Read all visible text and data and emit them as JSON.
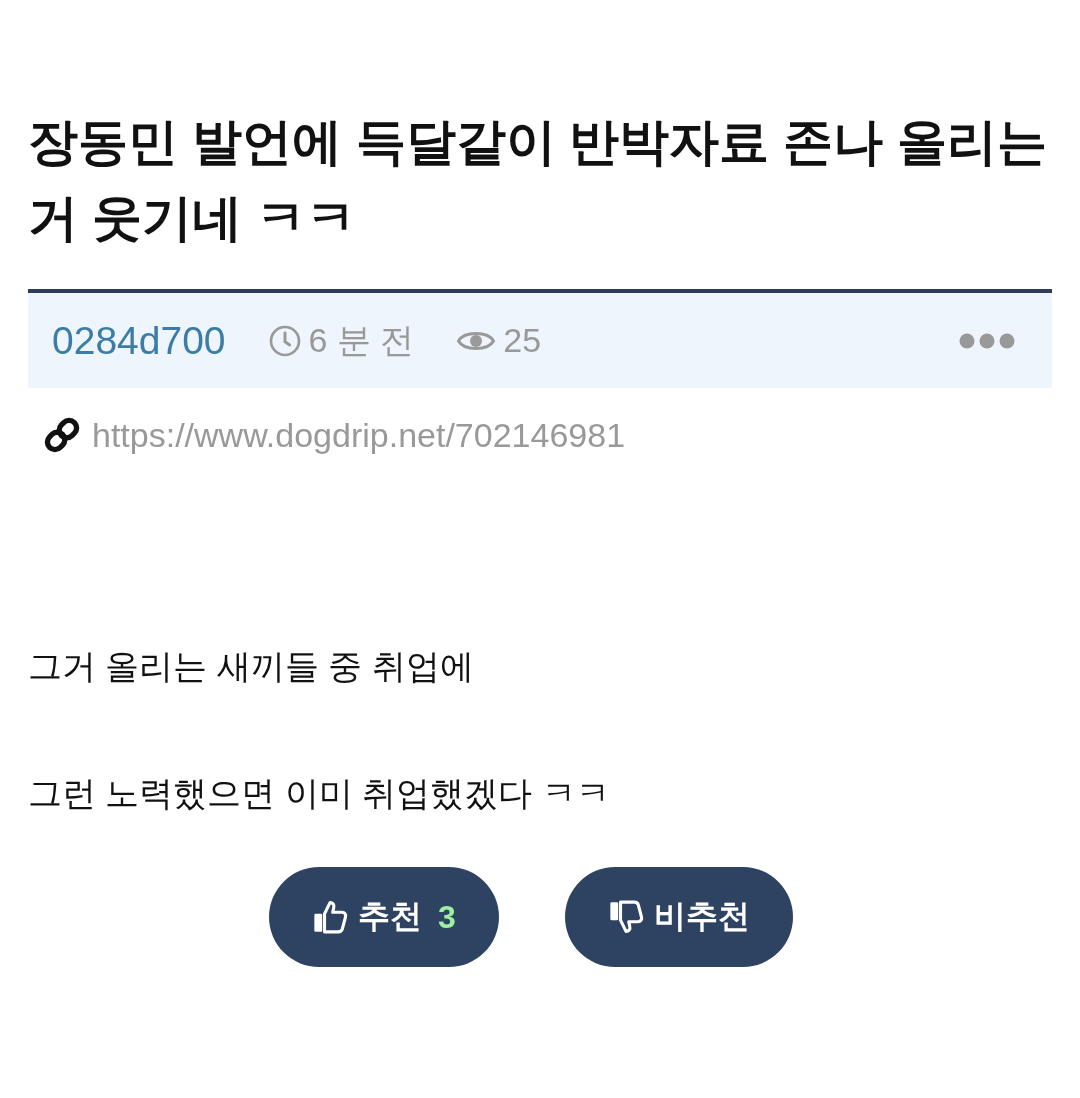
{
  "post": {
    "title": "장동민 발언에 득달같이 반박자료 존나 올리는 거 웃기네 ㅋㅋ"
  },
  "meta": {
    "author": "0284d700",
    "time": "6 분 전",
    "views": "25"
  },
  "link": {
    "url": "https://www.dogdrip.net/702146981"
  },
  "body": [
    "그거 올리는 새끼들 중 취업에",
    "그런 노력했으면 이미 취업했겠다 ㅋㅋ"
  ],
  "votes": [
    {
      "kind": "up",
      "label": "추천",
      "count": "3"
    },
    {
      "kind": "down",
      "label": "비추천"
    }
  ]
}
